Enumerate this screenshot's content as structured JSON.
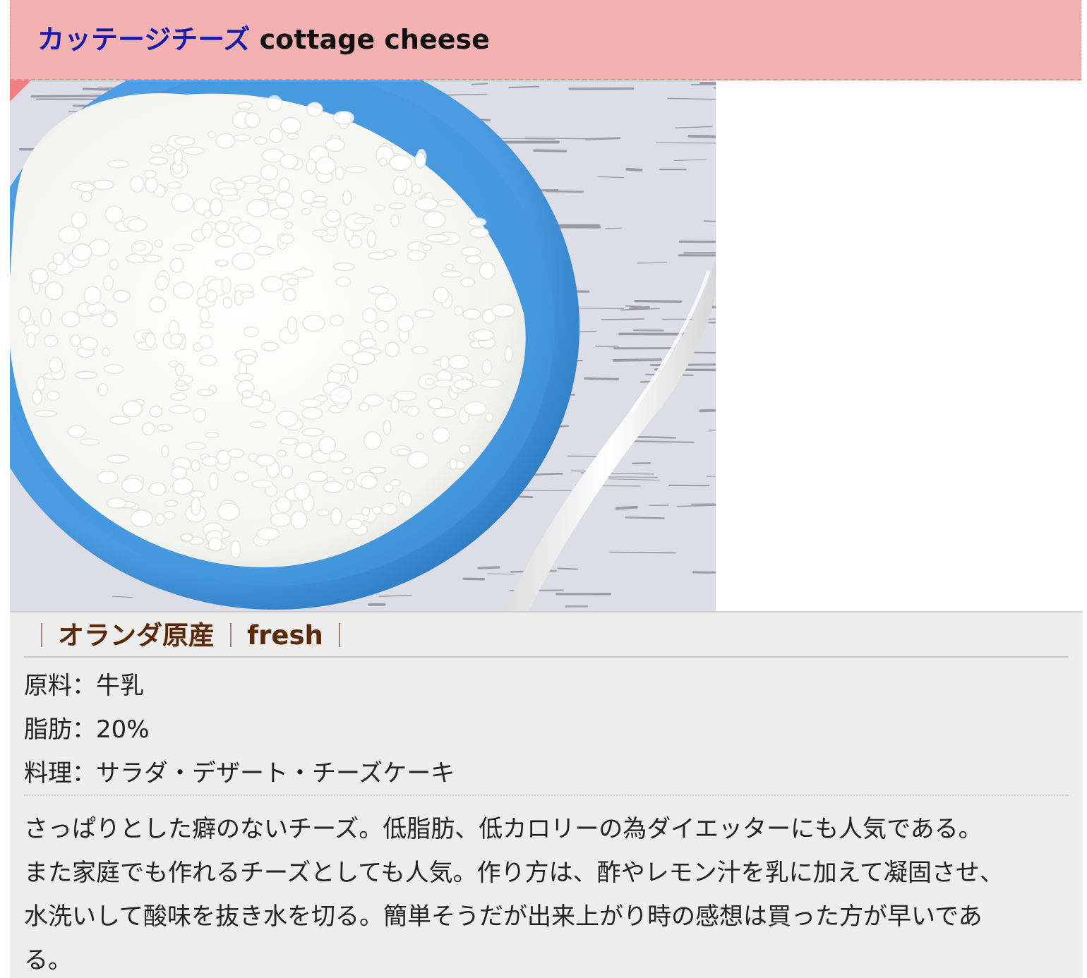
{
  "title": {
    "jp": "カッテージチーズ",
    "en": "cottage cheese"
  },
  "photo": {
    "subject": "cottage cheese in a blue bowl with a white spoon on a white wooden table",
    "colors": {
      "bowl": "#4a9be0",
      "cheese": "#f7f7f4",
      "table": "#dcdde6",
      "wood_grain": "#6a6474",
      "spoon": "#f3f3f3"
    }
  },
  "tags": {
    "origin": "オランダ原産",
    "type": "fresh",
    "separator": "｜"
  },
  "specs": [
    {
      "label": "原料",
      "sep": "：",
      "value": "牛乳"
    },
    {
      "label": "脂肪",
      "sep": "：",
      "value": "20%"
    },
    {
      "label": "料理",
      "sep": "：",
      "value": "サラダ・デザート・チーズケーキ"
    }
  ],
  "description": [
    "さっぱりとした癖のないチーズ。低脂肪、低カロリーの為ダイエッターにも人気である。",
    "また家庭でも作れるチーズとしても人気。作り方は、酢やレモン汁を乳に加えて凝固させ、",
    "水洗いして酸味を抜き水を切る。簡単そうだが出来上がり時の感想は買った方が早いであ",
    "る。"
  ],
  "colors": {
    "title_bg": "#f4b1b1",
    "title_jp": "#1a1aa8",
    "tag_text": "#5a2a08",
    "panel_bg": "#eeeeee"
  }
}
